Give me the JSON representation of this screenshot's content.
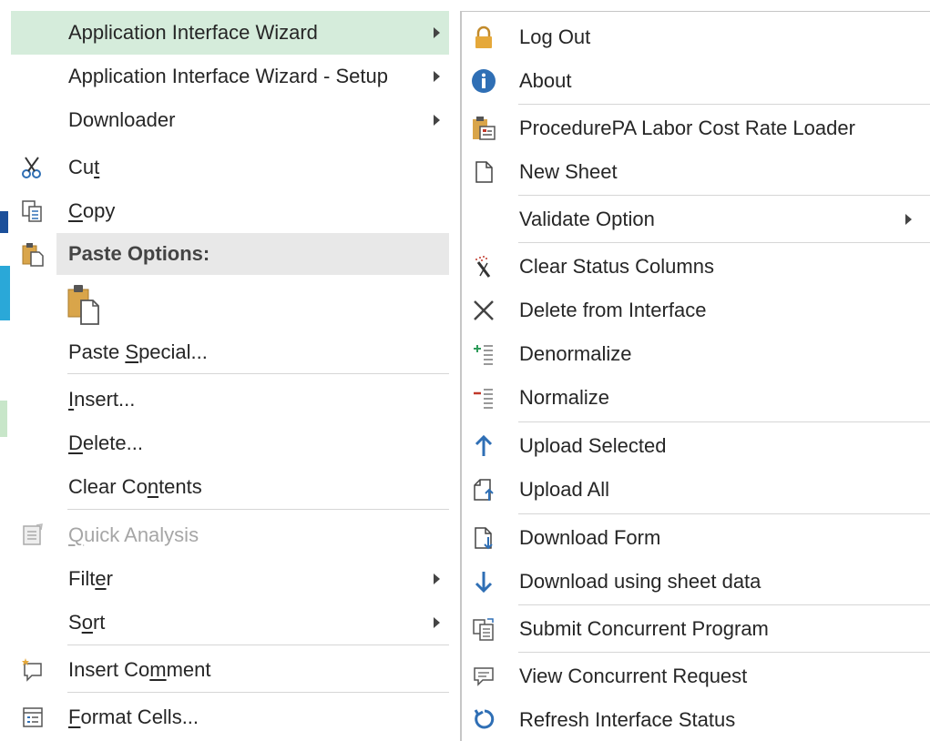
{
  "left_menu": {
    "items": [
      {
        "label": "Application Interface Wizard",
        "submenu": true,
        "highlighted": true
      },
      {
        "label": "Application Interface Wizard - Setup",
        "submenu": true
      },
      {
        "label": "Downloader",
        "submenu": true
      },
      {
        "label_parts": [
          "Cu",
          "t",
          ""
        ],
        "icon": "scissors-icon"
      },
      {
        "label_parts": [
          "",
          "C",
          "opy"
        ],
        "icon": "copy-icon"
      },
      {
        "label": "Paste Options:",
        "icon": "clipboard-icon",
        "section_header": true
      },
      {
        "icon": "paste-icon",
        "icon_only": true
      },
      {
        "label_parts": [
          "Paste ",
          "S",
          "pecial..."
        ]
      },
      {
        "label_parts": [
          "",
          "I",
          "nsert..."
        ]
      },
      {
        "label_parts": [
          "",
          "D",
          "elete..."
        ]
      },
      {
        "label_parts": [
          "Clear Co",
          "n",
          "tents"
        ]
      },
      {
        "label_parts": [
          "",
          "Q",
          "uick Analysis"
        ],
        "icon": "quick-analysis-icon",
        "disabled": true
      },
      {
        "label_parts": [
          "Filt",
          "e",
          "r"
        ],
        "submenu": true
      },
      {
        "label_parts": [
          "S",
          "o",
          "rt"
        ],
        "submenu": true
      },
      {
        "label_parts": [
          "Insert Co",
          "m",
          "ment"
        ],
        "icon": "insert-comment-icon"
      },
      {
        "label_parts": [
          "",
          "F",
          "ormat Cells..."
        ],
        "icon": "format-cells-icon"
      }
    ]
  },
  "right_menu": {
    "items": [
      {
        "label": "Log Out",
        "icon": "lock-icon"
      },
      {
        "label": "About",
        "icon": "info-icon"
      },
      {
        "label": "ProcedurePA Labor Cost Rate Loader",
        "icon": "procedure-icon"
      },
      {
        "label": "New Sheet",
        "icon": "new-sheet-icon"
      },
      {
        "label": "Validate Option",
        "submenu": true
      },
      {
        "label": "Clear Status Columns",
        "icon": "clear-status-icon"
      },
      {
        "label": "Delete from Interface",
        "icon": "delete-x-icon"
      },
      {
        "label": "Denormalize",
        "icon": "denormalize-icon"
      },
      {
        "label": "Normalize",
        "icon": "normalize-icon"
      },
      {
        "label": "Upload Selected",
        "icon": "arrow-up-icon"
      },
      {
        "label": "Upload All",
        "icon": "upload-all-icon"
      },
      {
        "label": "Download Form",
        "icon": "download-form-icon"
      },
      {
        "label": "Download using sheet data",
        "icon": "arrow-down-icon"
      },
      {
        "label": "Submit Concurrent Program",
        "icon": "submit-program-icon"
      },
      {
        "label": "View Concurrent Request",
        "icon": "view-request-icon"
      },
      {
        "label": "Refresh Interface Status",
        "icon": "refresh-icon"
      }
    ]
  },
  "colors": {
    "highlight": "#d5ecdb",
    "section_header_bg": "#e8e8e8",
    "accent_blue": "#2f6fb5",
    "lock_gold": "#e5a83a",
    "red_accent": "#c0392b",
    "green_accent": "#2e9b5a"
  }
}
